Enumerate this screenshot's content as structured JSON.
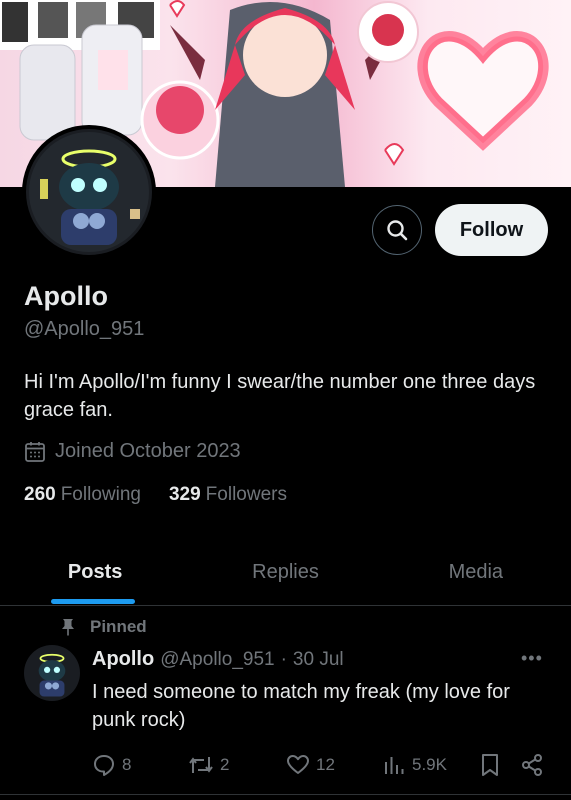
{
  "profile": {
    "name": "Apollo",
    "handle": "@Apollo_951",
    "bio": "Hi I'm Apollo/I'm funny I swear/the number one three days grace fan.",
    "joined": "Joined October 2023",
    "following_count": "260",
    "following_label": "Following",
    "followers_count": "329",
    "followers_label": "Followers"
  },
  "header": {
    "follow_label": "Follow",
    "search_icon": "search-icon"
  },
  "tabs": [
    {
      "label": "Posts",
      "active": true
    },
    {
      "label": "Replies",
      "active": false
    },
    {
      "label": "Media",
      "active": false
    }
  ],
  "post": {
    "pinned_label": "Pinned",
    "author": "Apollo",
    "handle": "@Apollo_951",
    "separator": "·",
    "date": "30 Jul",
    "more": "•••",
    "text": "I need someone to match my freak (my love for punk rock)",
    "replies": "8",
    "reposts": "2",
    "likes": "12",
    "views": "5.9K"
  },
  "colors": {
    "background": "#000000",
    "text_primary": "#e7e9ea",
    "text_secondary": "#71767b",
    "accent": "#1d9bf0",
    "follow_bg": "#eff3f4",
    "border": "#2f3336"
  }
}
